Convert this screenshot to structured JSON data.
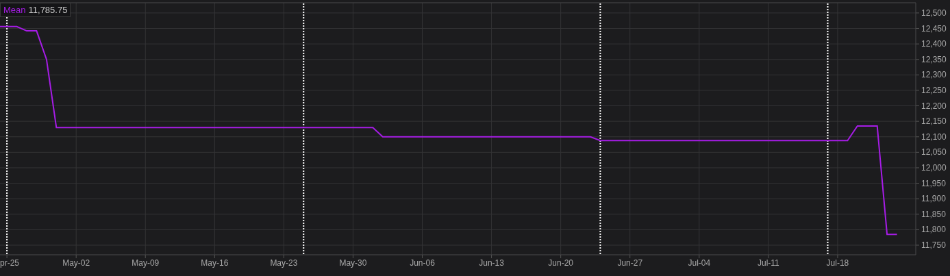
{
  "chart": {
    "legend_value": "11,785.75",
    "chart_data": {
      "type": "line",
      "categories": [
        "pr-25",
        null,
        null,
        null,
        null,
        null,
        null,
        "May-02",
        null,
        null,
        null,
        null,
        null,
        null,
        "May-09",
        null,
        null,
        null,
        null,
        null,
        null,
        "May-16",
        null,
        null,
        null,
        null,
        null,
        null,
        "May-23",
        null,
        null,
        null,
        null,
        null,
        null,
        "May-30",
        null,
        null,
        null,
        null,
        null,
        null,
        "Jun-06",
        null,
        null,
        null,
        null,
        null,
        null,
        "Jun-13",
        null,
        null,
        null,
        null,
        null,
        null,
        "Jun-20",
        null,
        null,
        null,
        null,
        null,
        null,
        "Jun-27",
        null,
        null,
        null,
        null,
        null,
        null,
        "Jul-04",
        null,
        null,
        null,
        null,
        null,
        null,
        "Jul-11",
        null,
        null,
        null,
        null,
        null,
        null,
        "Jul-18",
        null,
        null,
        null,
        null,
        null,
        null
      ],
      "series": [
        {
          "name": "Mean",
          "color": "#a61ce6",
          "values": [
            12456,
            12456,
            12442,
            12442,
            12350,
            12130,
            12130,
            12130,
            12130,
            12130,
            12130,
            12130,
            12130,
            12130,
            12130,
            12130,
            12130,
            12130,
            12130,
            12130,
            12130,
            12130,
            12130,
            12130,
            12130,
            12130,
            12130,
            12130,
            12130,
            12130,
            12130,
            12130,
            12130,
            12130,
            12130,
            12130,
            12130,
            12130,
            12100,
            12100,
            12100,
            12100,
            12100,
            12100,
            12100,
            12100,
            12100,
            12100,
            12100,
            12100,
            12100,
            12100,
            12100,
            12100,
            12100,
            12100,
            12100,
            12100,
            12100,
            12100,
            12088,
            12088,
            12088,
            12088,
            12088,
            12088,
            12088,
            12088,
            12088,
            12088,
            12088,
            12088,
            12088,
            12088,
            12088,
            12088,
            12088,
            12088,
            12088,
            12088,
            12088,
            12088,
            12088,
            12088,
            12088,
            12088,
            12135,
            12135,
            12135,
            11785,
            11785
          ]
        }
      ],
      "grid": true,
      "ylim": [
        11719,
        12533
      ],
      "yticks": [
        {
          "value": 11750,
          "label": "11,750"
        },
        {
          "value": 11800,
          "label": "11,800"
        },
        {
          "value": 11850,
          "label": "11,850"
        },
        {
          "value": 11900,
          "label": "11,900"
        },
        {
          "value": 11950,
          "label": "11,950"
        },
        {
          "value": 12000,
          "label": "12,000"
        },
        {
          "value": 12050,
          "label": "12,050"
        },
        {
          "value": 12100,
          "label": "12,100"
        },
        {
          "value": 12150,
          "label": "12,150"
        },
        {
          "value": 12200,
          "label": "12,200"
        },
        {
          "value": 12250,
          "label": "12,250"
        },
        {
          "value": 12300,
          "label": "12,300"
        },
        {
          "value": 12350,
          "label": "12,350"
        },
        {
          "value": 12400,
          "label": "12,400"
        },
        {
          "value": 12450,
          "label": "12,450"
        },
        {
          "value": 12500,
          "label": "12,500"
        }
      ]
    }
  }
}
